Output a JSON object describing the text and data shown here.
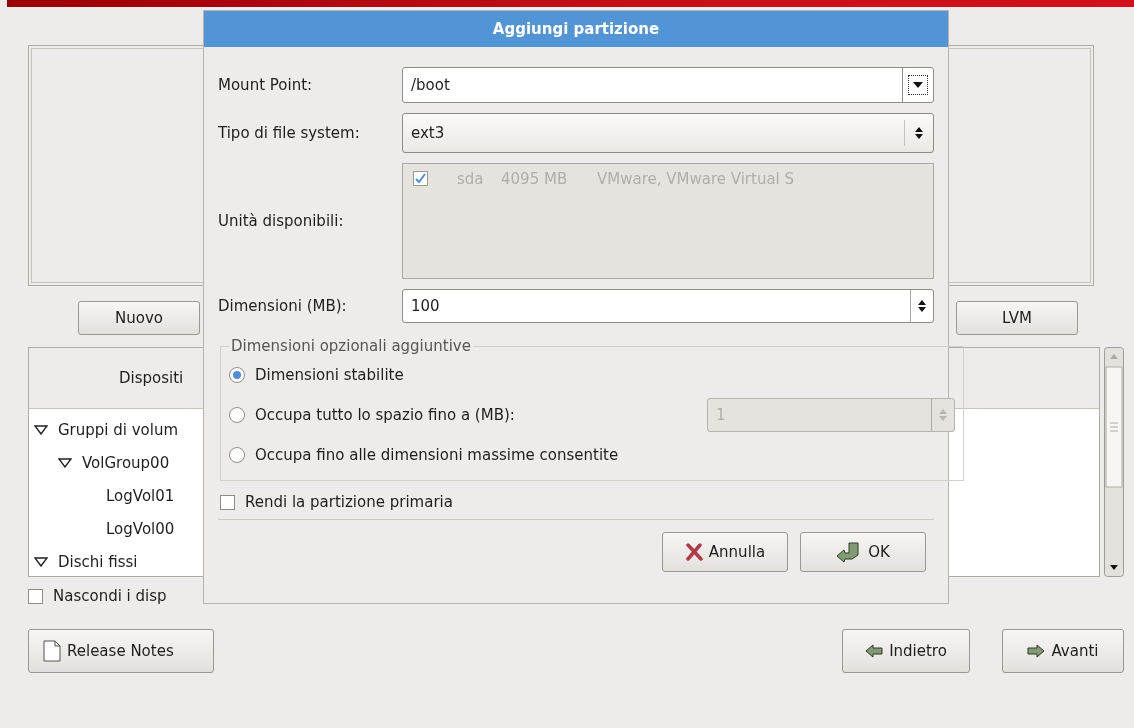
{
  "background": {
    "new_button": "Nuovo",
    "lvm_button": "LVM",
    "tree": {
      "header": "Dispositi",
      "items": [
        {
          "label": "Gruppi di volum",
          "expanded": true,
          "children": [
            {
              "label": "VolGroup00",
              "expanded": true,
              "children": [
                {
                  "label": "LogVol01"
                },
                {
                  "label": "LogVol00"
                }
              ]
            }
          ]
        },
        {
          "label": "Dischi fissi",
          "expanded": true
        }
      ]
    },
    "hide_checkbox": {
      "label": "Nascondi i disp",
      "checked": false
    },
    "release_notes_button": "Release Notes",
    "back_button": "Indietro",
    "next_button": "Avanti"
  },
  "dialog": {
    "title": "Aggiungi partizione",
    "mount_point": {
      "label": "Mount Point:",
      "value": "/boot"
    },
    "fs_type": {
      "label": "Tipo di file system:",
      "value": "ext3"
    },
    "drives": {
      "label": "Unità disponibili:",
      "disabled": true,
      "rows": [
        {
          "checked": true,
          "name": "sda",
          "size": "4095 MB",
          "model": "VMware, VMware Virtual S"
        }
      ]
    },
    "size": {
      "label": "Dimensioni (MB):",
      "value": "100"
    },
    "options": {
      "legend": "Dimensioni opzionali aggiuntive",
      "choices": [
        {
          "label": "Dimensioni stabilite",
          "selected": true
        },
        {
          "label": "Occupa tutto lo spazio fino a (MB):",
          "selected": false,
          "field": {
            "value": "1",
            "disabled": true
          }
        },
        {
          "label": "Occupa fino alle dimensioni massime consentite",
          "selected": false
        }
      ]
    },
    "primary": {
      "label": "Rendi la partizione primaria",
      "checked": false
    },
    "cancel_button": "Annulla",
    "ok_button": "OK"
  }
}
